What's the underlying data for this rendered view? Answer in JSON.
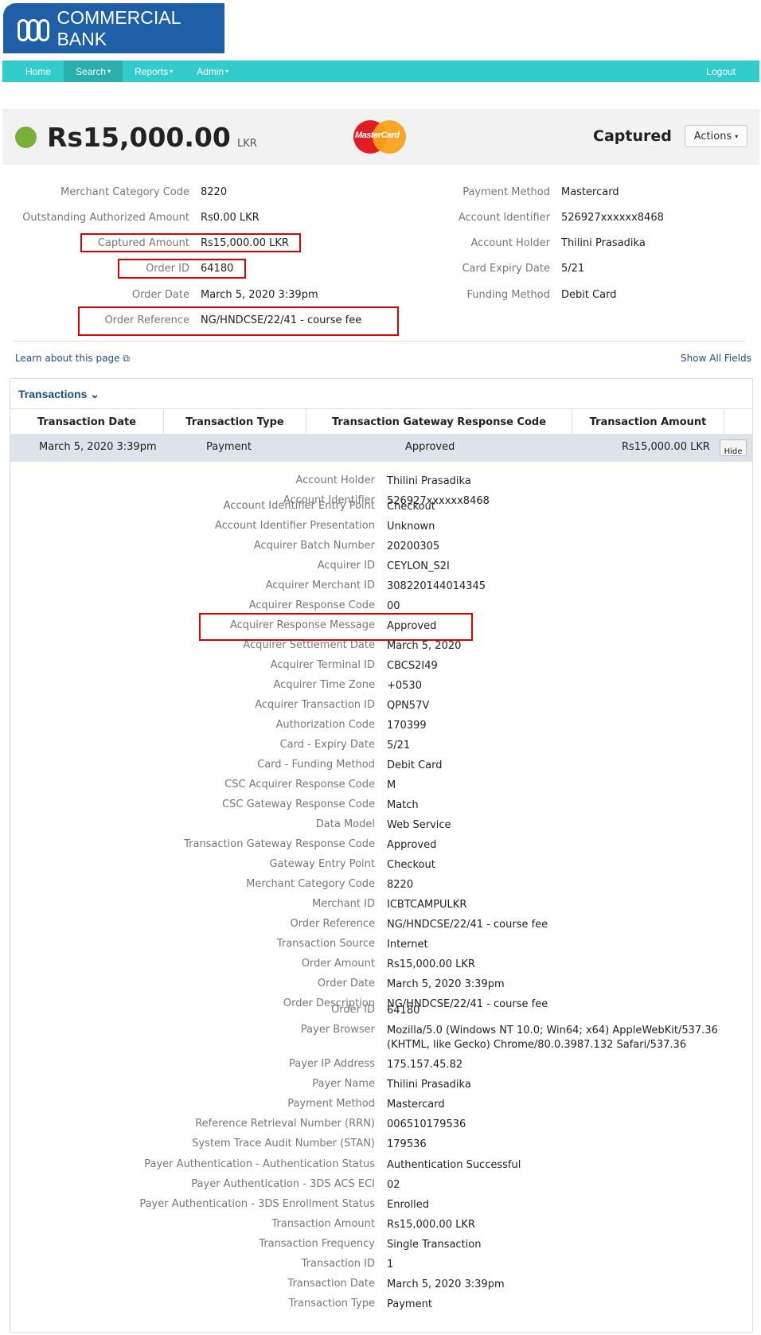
{
  "brand": {
    "name": "COMMERCIAL BANK"
  },
  "nav": {
    "home": "Home",
    "search": "Search",
    "reports": "Reports",
    "admin": "Admin",
    "logout": "Logout"
  },
  "summary": {
    "amount": "Rs15,000.00",
    "currency": "LKR",
    "card_brand": "MasterCard",
    "status": "Captured",
    "actions": "Actions"
  },
  "left_fields": [
    {
      "label": "Merchant Category Code",
      "value": "8220"
    },
    {
      "label": "Outstanding Authorized Amount",
      "value": "Rs0.00 LKR"
    },
    {
      "label": "Captured Amount",
      "value": "Rs15,000.00 LKR"
    },
    {
      "label": "Order ID",
      "value": "64180"
    },
    {
      "label": "Order Date",
      "value": "March 5, 2020 3:39pm"
    },
    {
      "label": "Order Reference",
      "value": "NG/HNDCSE/22/41 - course fee"
    }
  ],
  "right_fields": [
    {
      "label": "Payment Method",
      "value": "Mastercard"
    },
    {
      "label": "Account Identifier",
      "value": "526927xxxxxx8468"
    },
    {
      "label": "Account Holder",
      "value": "Thilini Prasadika"
    },
    {
      "label": "Card Expiry Date",
      "value": "5/21"
    },
    {
      "label": "Funding Method",
      "value": "Debit Card"
    }
  ],
  "links": {
    "learn": "Learn about this page",
    "show_all": "Show All Fields"
  },
  "transactions": {
    "title": "Transactions",
    "columns": [
      "Transaction Date",
      "Transaction Type",
      "Transaction Gateway Response Code",
      "Transaction Amount"
    ],
    "row": {
      "date": "March 5, 2020 3:39pm",
      "type": "Payment",
      "code": "Approved",
      "amount": "Rs15,000.00 LKR",
      "hide": "Hide"
    }
  },
  "details": [
    {
      "label": "Account Holder",
      "value": "Thilini Prasadika"
    },
    {
      "label": "Account Identifier",
      "value": "526927xxxxxx8468"
    },
    {
      "label": "Account Identifier Entry Point",
      "value": "Checkout"
    },
    {
      "label": "Account Identifier Presentation",
      "value": "Unknown"
    },
    {
      "label": "Acquirer Batch Number",
      "value": "20200305"
    },
    {
      "label": "Acquirer ID",
      "value": "CEYLON_S2I"
    },
    {
      "label": "Acquirer Merchant ID",
      "value": "308220144014345"
    },
    {
      "label": "Acquirer Response Code",
      "value": "00"
    },
    {
      "label": "Acquirer Response Message",
      "value": "Approved"
    },
    {
      "label": "Acquirer Settlement Date",
      "value": "March 5, 2020"
    },
    {
      "label": "Acquirer Terminal ID",
      "value": "CBCS2I49"
    },
    {
      "label": "Acquirer Time Zone",
      "value": "+0530"
    },
    {
      "label": "Acquirer Transaction ID",
      "value": "QPN57V"
    },
    {
      "label": "Authorization Code",
      "value": "170399"
    },
    {
      "label": "Card - Expiry Date",
      "value": "5/21"
    },
    {
      "label": "Card - Funding Method",
      "value": "Debit Card"
    },
    {
      "label": "CSC Acquirer Response Code",
      "value": "M"
    },
    {
      "label": "CSC Gateway Response Code",
      "value": "Match"
    },
    {
      "label": "Data Model",
      "value": "Web Service"
    },
    {
      "label": "Transaction Gateway Response Code",
      "value": "Approved"
    },
    {
      "label": "Gateway Entry Point",
      "value": "Checkout"
    },
    {
      "label": "Merchant Category Code",
      "value": "8220"
    },
    {
      "label": "Merchant ID",
      "value": "ICBTCAMPULKR"
    },
    {
      "label": "Order Reference",
      "value": "NG/HNDCSE/22/41 - course fee"
    },
    {
      "label": "Transaction Source",
      "value": "Internet"
    },
    {
      "label": "Order Amount",
      "value": "Rs15,000.00 LKR"
    },
    {
      "label": "Order Date",
      "value": "March 5, 2020 3:39pm"
    },
    {
      "label": "Order Description",
      "value": "NG/HNDCSE/22/41 - course fee"
    },
    {
      "label": "Order ID",
      "value": "64180"
    },
    {
      "label": "Payer Browser",
      "value": "Mozilla/5.0 (Windows NT 10.0; Win64; x64) AppleWebKit/537.36",
      "value2": "(KHTML, like Gecko) Chrome/80.0.3987.132 Safari/537.36"
    },
    {
      "label": "Payer IP Address",
      "value": "175.157.45.82"
    },
    {
      "label": "Payer Name",
      "value": "Thilini Prasadika"
    },
    {
      "label": "Payment Method",
      "value": "Mastercard"
    },
    {
      "label": "Reference Retrieval Number (RRN)",
      "value": "006510179536"
    },
    {
      "label": "System Trace Audit Number (STAN)",
      "value": "179536"
    },
    {
      "label": "Payer Authentication - Authentication Status",
      "value": "Authentication Successful"
    },
    {
      "label": "Payer Authentication - 3DS ACS ECI",
      "value": "02"
    },
    {
      "label": "Payer Authentication - 3DS Enrollment Status",
      "value": "Enrolled"
    },
    {
      "label": "Transaction Amount",
      "value": "Rs15,000.00 LKR"
    },
    {
      "label": "Transaction Frequency",
      "value": "Single Transaction"
    },
    {
      "label": "Transaction ID",
      "value": "1"
    },
    {
      "label": "Transaction Date",
      "value": "March 5, 2020 3:39pm"
    },
    {
      "label": "Transaction Type",
      "value": "Payment"
    }
  ]
}
